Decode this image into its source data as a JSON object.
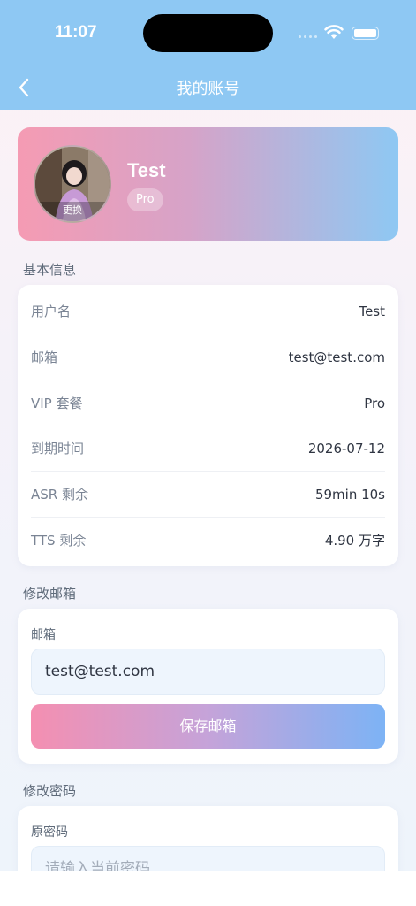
{
  "status_bar": {
    "time": "11:07"
  },
  "nav": {
    "title": "我的账号"
  },
  "profile": {
    "name": "Test",
    "badge": "Pro",
    "avatar_change": "更换"
  },
  "basic_info": {
    "title": "基本信息",
    "rows": [
      {
        "label": "用户名",
        "value": "Test"
      },
      {
        "label": "邮箱",
        "value": "test@test.com"
      },
      {
        "label": "VIP 套餐",
        "value": "Pro"
      },
      {
        "label": "到期时间",
        "value": "2026-07-12"
      },
      {
        "label": "ASR 剩余",
        "value": "59min 10s"
      },
      {
        "label": "TTS 剩余",
        "value": "4.90 万字"
      }
    ]
  },
  "change_email": {
    "title": "修改邮箱",
    "field_label": "邮箱",
    "value": "test@test.com",
    "button": "保存邮箱"
  },
  "change_password": {
    "title": "修改密码",
    "old_label": "原密码",
    "old_placeholder": "请输入当前密码"
  },
  "colors": {
    "nav_bg": "#8ec8f3",
    "accent_pink": "#f48fb1",
    "accent_blue": "#7db3f5"
  }
}
